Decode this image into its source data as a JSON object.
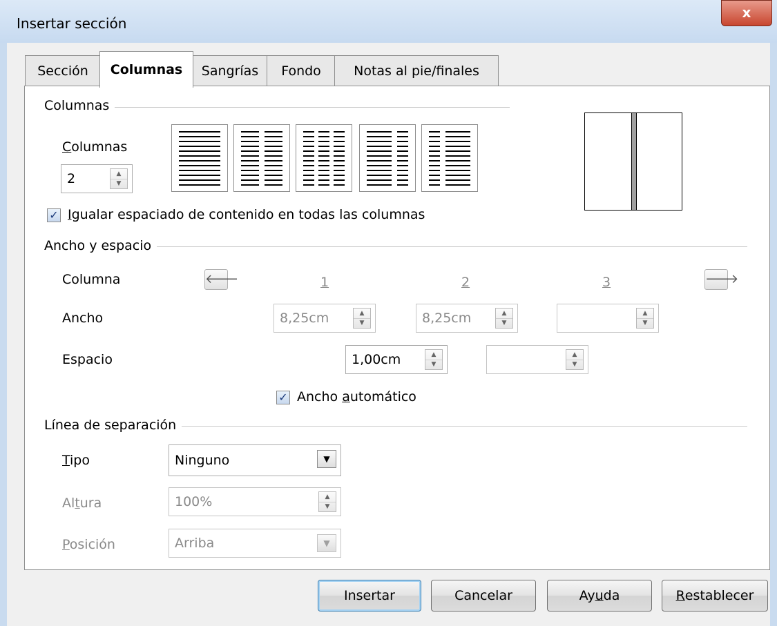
{
  "window": {
    "title": "Insertar sección",
    "close_glyph": "x"
  },
  "tabs": [
    {
      "label": "Sección",
      "active": false
    },
    {
      "label": "Columnas",
      "active": true
    },
    {
      "label": "Sangrías",
      "active": false
    },
    {
      "label": "Fondo",
      "active": false
    },
    {
      "label": "Notas al pie/finales",
      "active": false
    }
  ],
  "columns_group": {
    "title": "Columnas",
    "count_label_ul": "C",
    "count_label_rest": "olumnas",
    "count_value": "2",
    "presets": [
      "1 columna",
      "2 columnas",
      "3 columnas",
      "2 columnas (ancha izquierda)",
      "2 columnas (ancha derecha)"
    ]
  },
  "equalize": {
    "checked": true,
    "label_ul": "I",
    "label_rest": "gualar espaciado de contenido en todas las columnas"
  },
  "width_spacing": {
    "title": "Ancho y espacio",
    "column_label": "Columna",
    "col_numbers": [
      "1",
      "2",
      "3"
    ],
    "width_label": "Ancho",
    "widths": [
      "8,25cm",
      "8,25cm",
      ""
    ],
    "spacing_label": "Espacio",
    "spacings": [
      "1,00cm",
      ""
    ],
    "auto_width": {
      "checked": true,
      "label_pre": "Ancho ",
      "label_ul": "a",
      "label_post": "utomático"
    }
  },
  "separator": {
    "title": "Línea de separación",
    "type_label_ul": "T",
    "type_label_rest": "ipo",
    "type_value": "Ninguno",
    "height_label_pre": "Al",
    "height_label_ul": "t",
    "height_label_post": "ura",
    "height_value": "100%",
    "position_label_ul": "P",
    "position_label_rest": "osición",
    "position_value": "Arriba"
  },
  "buttons": {
    "insert": "Insertar",
    "cancel": "Cancelar",
    "help_pre": "Ay",
    "help_ul": "u",
    "help_post": "da",
    "reset_ul": "R",
    "reset_rest": "establecer"
  },
  "icons": {
    "close": "close-icon",
    "spin": "spin-arrows-icon",
    "left_arrow": "arrow-left-icon",
    "right_arrow": "arrow-right-icon",
    "dropdown": "chevron-down-icon",
    "check": "checkmark-icon"
  }
}
